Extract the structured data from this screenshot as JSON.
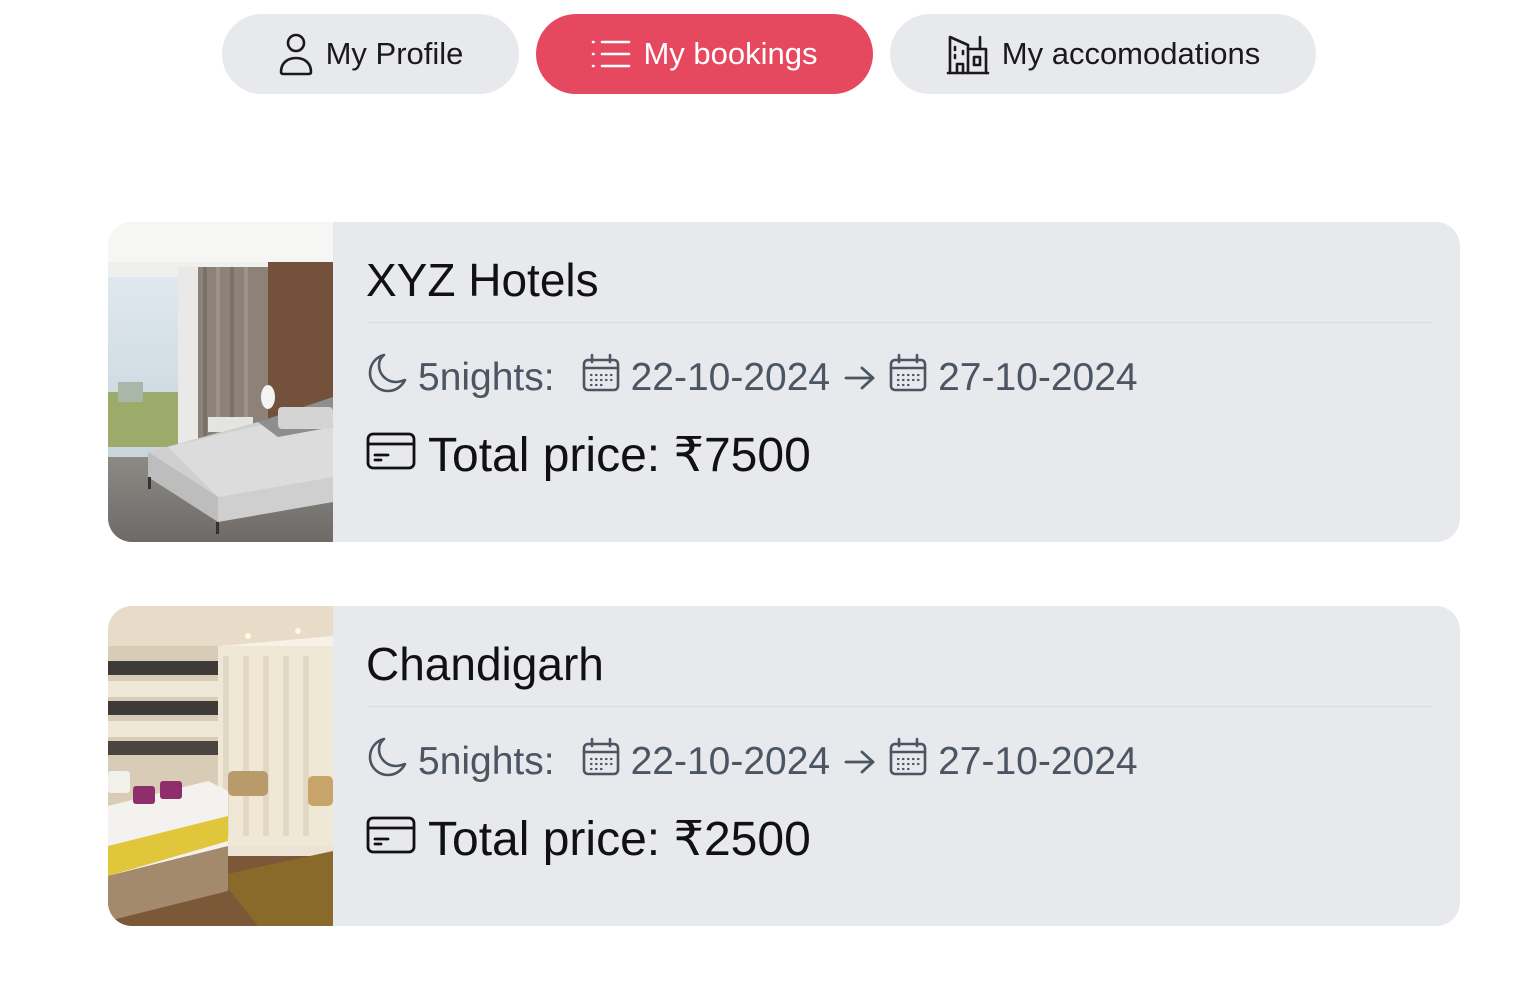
{
  "nav": {
    "tabs": [
      {
        "label": "My Profile",
        "icon": "user-icon",
        "active": false
      },
      {
        "label": "My bookings",
        "icon": "list-icon",
        "active": true
      },
      {
        "label": "My accomodations",
        "icon": "building-icon",
        "active": false
      }
    ]
  },
  "colors": {
    "accent": "#e5485f",
    "card_bg": "#e8e9ec",
    "muted_text": "#4b5563"
  },
  "bookings": [
    {
      "title": "XYZ Hotels",
      "nights": "5nights:",
      "check_in": "22-10-2024",
      "check_out": "27-10-2024",
      "price": "Total price: ₹7500",
      "photo": "hotel-room-photo"
    },
    {
      "title": "Chandigarh",
      "nights": "5nights:",
      "check_in": "22-10-2024",
      "check_out": "27-10-2024",
      "price": "Total price: ₹2500",
      "photo": "hotel-room-photo"
    }
  ]
}
